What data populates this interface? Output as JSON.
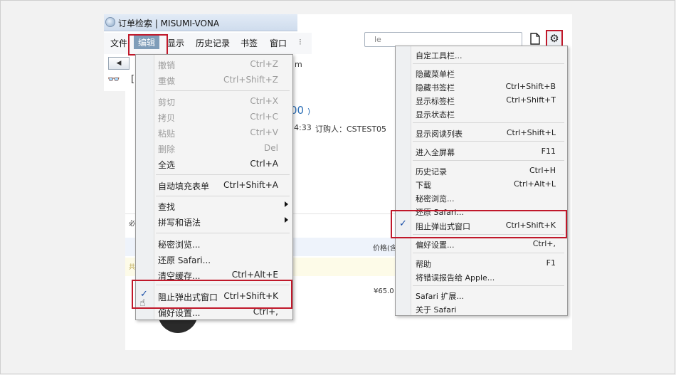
{
  "window": {
    "title": "订单检索 | MISUMI-VONA"
  },
  "menubar": {
    "items": [
      {
        "label": "文件"
      },
      {
        "label": "编辑"
      },
      {
        "label": "显示"
      },
      {
        "label": "历史记录"
      },
      {
        "label": "书签"
      },
      {
        "label": "窗口"
      }
    ]
  },
  "address": {
    "fragment": "le"
  },
  "toolbar": {
    "back_glyph": "◀",
    "reading_glyph": "👓",
    "bracket_glyph": "["
  },
  "page_fragments": {
    "number_suffix": "00",
    "paren": ")",
    "time_fragment": "4:33",
    "buyer": "订购人：CSTEST05",
    "price_label": "价格(含",
    "price_value": "¥65.0",
    "side_mark_1": "必",
    "side_mark_2": "共",
    "menu_tail_letter": "m"
  },
  "edit_menu": {
    "items": [
      {
        "label": "撤销",
        "shortcut": "Ctrl+Z",
        "disabled": true
      },
      {
        "label": "重做",
        "shortcut": "Ctrl+Shift+Z",
        "disabled": true
      },
      {
        "label": "剪切",
        "shortcut": "Ctrl+X",
        "disabled": true
      },
      {
        "label": "拷贝",
        "shortcut": "Ctrl+C",
        "disabled": true
      },
      {
        "label": "粘贴",
        "shortcut": "Ctrl+V",
        "disabled": true
      },
      {
        "label": "删除",
        "shortcut": "Del",
        "disabled": true
      },
      {
        "label": "全选",
        "shortcut": "Ctrl+A",
        "disabled": false
      },
      {
        "label": "自动填充表单",
        "shortcut": "Ctrl+Shift+A",
        "disabled": false
      },
      {
        "label": "查找",
        "shortcut": "",
        "disabled": false
      },
      {
        "label": "拼写和语法",
        "shortcut": "",
        "disabled": false
      },
      {
        "label": "秘密浏览...",
        "shortcut": "",
        "disabled": false
      },
      {
        "label": "还原 Safari...",
        "shortcut": "",
        "disabled": false
      },
      {
        "label": "清空缓存...",
        "shortcut": "Ctrl+Alt+E",
        "disabled": false
      },
      {
        "label": "阻止弹出式窗口",
        "shortcut": "Ctrl+Shift+K",
        "disabled": false,
        "checked": true
      },
      {
        "label": "偏好设置...",
        "shortcut": "Ctrl+,",
        "disabled": false
      }
    ],
    "check_glyph": "✓"
  },
  "gear_menu": {
    "items": [
      {
        "label": "自定工具栏...",
        "shortcut": ""
      },
      {
        "label": "隐藏菜单栏",
        "shortcut": ""
      },
      {
        "label": "隐藏书签栏",
        "shortcut": "Ctrl+Shift+B"
      },
      {
        "label": "显示标签栏",
        "shortcut": "Ctrl+Shift+T"
      },
      {
        "label": "显示状态栏",
        "shortcut": ""
      },
      {
        "label": "显示阅读列表",
        "shortcut": "Ctrl+Shift+L"
      },
      {
        "label": "进入全屏幕",
        "shortcut": "F11"
      },
      {
        "label": "历史记录",
        "shortcut": "Ctrl+H"
      },
      {
        "label": "下载",
        "shortcut": "Ctrl+Alt+L"
      },
      {
        "label": "秘密浏览...",
        "shortcut": ""
      },
      {
        "label": "还原 Safari...",
        "shortcut": ""
      },
      {
        "label": "阻止弹出式窗口",
        "shortcut": "Ctrl+Shift+K",
        "checked": true
      },
      {
        "label": "偏好设置...",
        "shortcut": "Ctrl+,"
      },
      {
        "label": "帮助",
        "shortcut": "F1"
      },
      {
        "label": "将错误报告给 Apple...",
        "shortcut": ""
      },
      {
        "label": "Safari 扩展...",
        "shortcut": ""
      },
      {
        "label": "关于 Safari",
        "shortcut": ""
      }
    ],
    "check_glyph": "✓"
  },
  "colors": {
    "highlight": "#c0182a",
    "active_menu": "#7f9db9",
    "check": "#1a4fa8"
  }
}
